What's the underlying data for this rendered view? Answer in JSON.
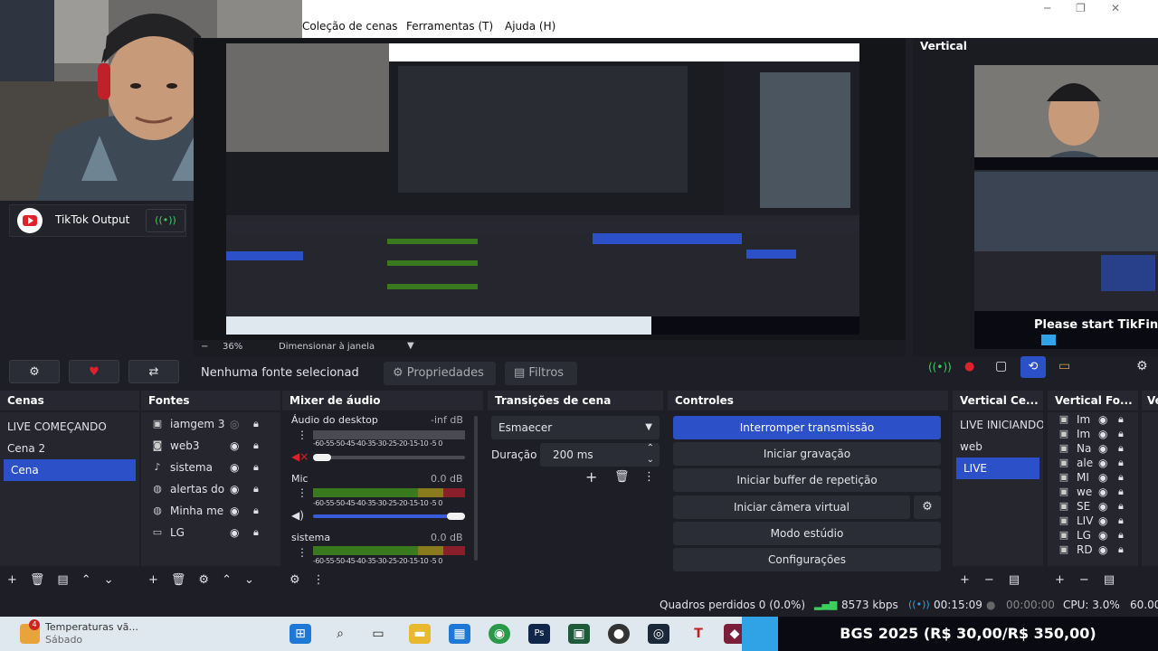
{
  "menu": {
    "items": [
      "Coleção de cenas",
      "Ferramentas (T)",
      "Ajuda (H)"
    ]
  },
  "vertical": {
    "title": "Vertical",
    "banner": "Please start TikFinit"
  },
  "tiktok": {
    "label": "TikTok Output"
  },
  "preview": {
    "zoom": "36%",
    "fit": "Dimensionar à janela"
  },
  "propbar": {
    "status": "Nenhuma fonte selecionad",
    "properties": "Propriedades",
    "filters": "Filtros"
  },
  "scenes": {
    "title": "Cenas",
    "items": [
      "LIVE COMEÇANDO",
      "Cena 2",
      "Cena"
    ],
    "selected_index": 2
  },
  "sources": {
    "title": "Fontes",
    "items": [
      {
        "label": "iamgem 3",
        "icon": "image-icon",
        "visible": false
      },
      {
        "label": "web3",
        "icon": "camera-icon",
        "visible": true
      },
      {
        "label": "sistema",
        "icon": "mic-icon",
        "visible": true
      },
      {
        "label": "alertas do",
        "icon": "browser-icon",
        "visible": true
      },
      {
        "label": "Minha me",
        "icon": "browser-icon",
        "visible": true
      },
      {
        "label": "LG",
        "icon": "monitor-icon",
        "visible": true
      }
    ]
  },
  "mixer": {
    "title": "Mixer de áudio",
    "channels": [
      {
        "name": "Áudio do desktop",
        "db": "-inf dB",
        "level": 0.0,
        "volume": 0.05
      },
      {
        "name": "Mic",
        "db": "0.0 dB",
        "level": 1.0,
        "volume": 0.98
      },
      {
        "name": "sistema",
        "db": "0.0 dB",
        "level": 1.0,
        "volume": null
      }
    ],
    "scale": "-60-55-50-45-40-35-30-25-20-15-10 -5 0"
  },
  "transitions": {
    "title": "Transições de cena",
    "selected": "Esmaecer",
    "duration_label": "Duração",
    "duration_value": "200 ms"
  },
  "controls": {
    "title": "Controles",
    "buttons": [
      "Interromper transmissão",
      "Iniciar gravação",
      "Iniciar buffer de repetição",
      "Iniciar câmera virtual",
      "Modo estúdio",
      "Configurações"
    ]
  },
  "vscenes": {
    "title": "Vertical Ce...",
    "items": [
      "LIVE INICIANDO",
      "web",
      "LIVE"
    ],
    "selected_index": 2
  },
  "vsources": {
    "title": "Vertical Fo...",
    "items": [
      "Im",
      "Im",
      "Na",
      "ale",
      "MI",
      "we",
      "SE",
      "LIV",
      "LG",
      "RD"
    ]
  },
  "vextra": {
    "title": "Ve"
  },
  "status": {
    "dropped": "Quadros perdidos 0 (0.0%)",
    "bitrate": "8573 kbps",
    "stream_time": "00:15:09",
    "rec_time": "00:00:00",
    "cpu": "CPU: 3.0%",
    "fps": "60.00"
  },
  "taskbar": {
    "notif_title": "Temperaturas vã...",
    "notif_sub": "Sábado",
    "notif_badge": "4",
    "ticker": "BGS 2025 (R$ 30,00/R$ 350,00)"
  },
  "colors": {
    "accent": "#2c50c8",
    "live": "#2fa3e6",
    "panel": "#25262e"
  }
}
